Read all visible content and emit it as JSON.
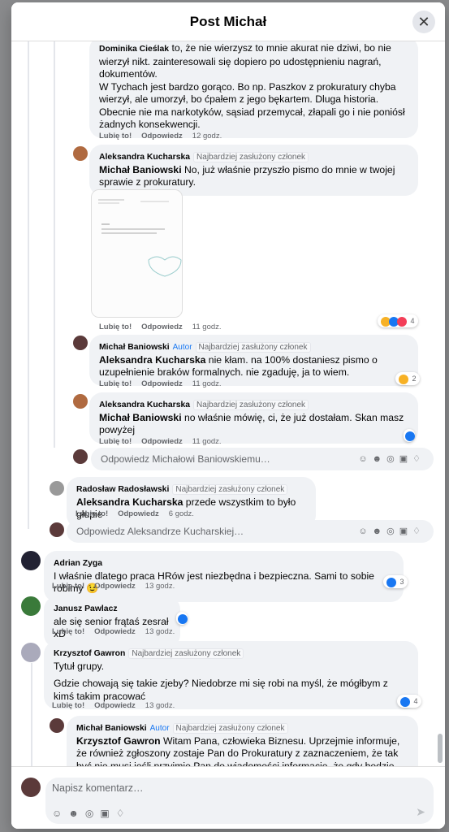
{
  "modal": {
    "title": "Post Michał",
    "close": "✕"
  },
  "common": {
    "like": "Lubię to!",
    "reply": "Odpowiedz",
    "top_member": "Najbardziej zasłużony członek",
    "author": "Autor"
  },
  "c1": {
    "name": "Dominika Cieślak",
    "text": " to, że nie wierzysz to mnie akurat nie dziwi, bo nie wierzył nikt. zainteresowali się dopiero po udostępnieniu nagrań, dokumentów.\nW Tychach jest bardzo gorąco. Bo np. Paszkov z prokuratury chyba wierzył, ale umorzył, bo ćpałem z jego bękartem. Dluga historia. Obecnie nie ma narkotyków, sąsiad przemycał, złapali go i nie poniósł żadnych konsekwencji.",
    "time": "12 godz."
  },
  "c2": {
    "name": "Aleksandra Kucharska",
    "mention": "Michał Baniowski",
    "text": " No, już właśnie przyszło pismo do mnie w twojej sprawie z prokuratury.",
    "time": "11 godz.",
    "doc_text": "Pozostaje ...",
    "reactions": "4"
  },
  "c3": {
    "name": "Michał Baniowski",
    "mention": "Aleksandra Kucharska",
    "text": " nie kłam. na 100% dostaniesz pismo o uzupełnienie braków formalnych. nie zgaduję, ja to wiem.",
    "time": "11 godz.",
    "reactions": "2"
  },
  "c4": {
    "name": "Aleksandra Kucharska",
    "mention": "Michał Baniowski",
    "text": " no właśnie mówię, ci, że już dostałam. Skan masz powyżej",
    "time": "11 godz."
  },
  "reply1": {
    "placeholder": "Odpowiedz Michałowi Baniowskiemu…"
  },
  "c5": {
    "name": "Radosław Radosławski",
    "mention": "Aleksandra Kucharska",
    "text": " przede wszystkim to było głupie",
    "time": "6 godz."
  },
  "reply2": {
    "placeholder": "Odpowiedz Aleksandrze Kucharskiej…"
  },
  "c6": {
    "name": "Adrian Zyga",
    "text": "I właśnie dlatego praca HRów jest niezbędna i bezpieczna. Sami to sobie robimy 😉",
    "time": "13 godz.",
    "reactions": "3"
  },
  "c7": {
    "name": "Janusz Pawlacz",
    "text": "ale się senior frątaś zesrał xD",
    "time": "13 godz."
  },
  "c8": {
    "name": "Krzysztof Gawron",
    "text1": "Tytuł grupy.",
    "text2": "Gdzie chowają się takie zjeby? Niedobrze mi się robi na myśl, że mógłbym z kimś takim pracować",
    "time": "13 godz.",
    "reactions": "4"
  },
  "c9": {
    "name": "Michał Baniowski",
    "mention": "Krzysztof Gawron",
    "text": " Witam Pana, człowieka Biznesu. Uprzejmie informuje, że również zgłoszony zostaje Pan do Prokuratury z zaznaczeniem, że tak być nie musi jeśli przyjmie Pan do wiadomości informację, że gdy będzie okazja"
  },
  "composer": {
    "placeholder": "Napisz komentarz…"
  },
  "colors": {
    "like_blue": "#1877f2",
    "bubble_bg": "#f0f2f5"
  }
}
